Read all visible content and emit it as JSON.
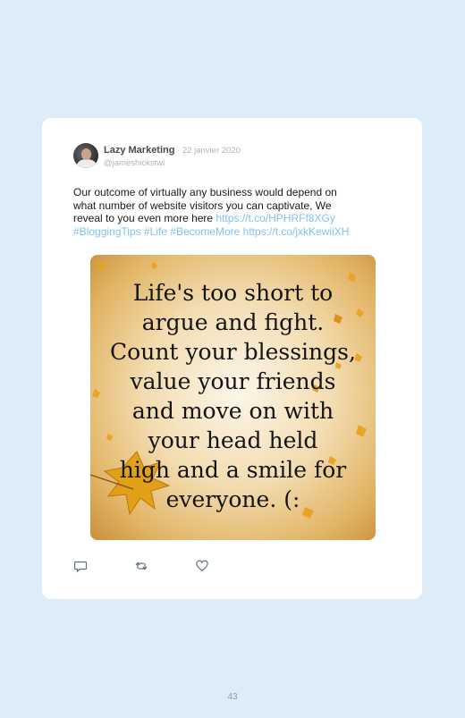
{
  "tweet": {
    "author_name": "Lazy Marketing",
    "separator": " · ",
    "date": "22 janvier 2020",
    "handle": "@jameshickstwi",
    "text_lines": [
      "Our outcome of virtually any business would depend on",
      "what number of website visitors you can captivate, We",
      "reveal to you even more here "
    ],
    "link_1": "https://t.co/HPHRFf8XGy",
    "hashtags": "#BloggingTips #Life #BecomeMore",
    "link_2": "https://t.co/jxkKewiiXH",
    "image_quote_lines": [
      "Life's too short to",
      "argue and fight.",
      "Count your blessings,",
      "value your friends",
      "and move on with",
      "your head held",
      "high and a smile for",
      "everyone. (:"
    ],
    "actions": {
      "reply_icon": "reply-icon",
      "retweet_icon": "retweet-icon",
      "like_icon": "heart-icon"
    }
  },
  "page_number": "43",
  "colors": {
    "background": "#ddecf7",
    "card": "#ffffff",
    "link": "#7fc2ee",
    "muted": "#a9b4be"
  }
}
